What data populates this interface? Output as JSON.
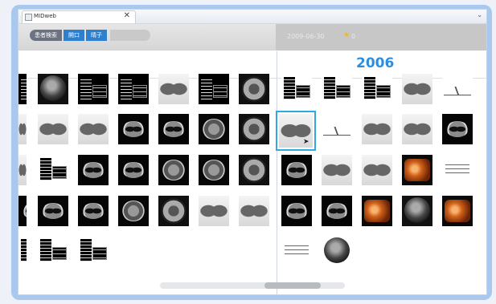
{
  "window": {
    "tab_title": "MIDweb"
  },
  "breadcrumb": {
    "items": [
      "患者検索",
      "開口",
      "晴子"
    ]
  },
  "study": {
    "date": "2009-06-30",
    "count": "0"
  },
  "year_label": "2006",
  "colors": {
    "accent": "#2d8ede",
    "breadcrumb_active": "#2f7fcf",
    "selection": "#33a8e0"
  }
}
